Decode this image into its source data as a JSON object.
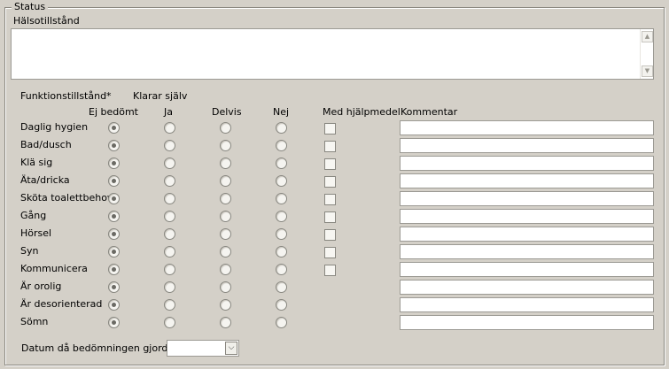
{
  "group_title": "Status",
  "health": {
    "label": "Hälsotillstånd",
    "value": ""
  },
  "function_header": "Funktionstillstånd*",
  "self_header": "Klarar själv",
  "columns": {
    "not_assessed": "Ej bedömt",
    "yes": "Ja",
    "partly": "Delvis",
    "no": "Nej",
    "aid": "Med hjälpmedel",
    "comment": "Kommentar"
  },
  "rows": [
    {
      "label": "Daglig hygien",
      "selected": "not_assessed",
      "has_aid": true
    },
    {
      "label": "Bad/dusch",
      "selected": "not_assessed",
      "has_aid": true
    },
    {
      "label": "Klä sig",
      "selected": "not_assessed",
      "has_aid": true
    },
    {
      "label": "Äta/dricka",
      "selected": "not_assessed",
      "has_aid": true
    },
    {
      "label": "Sköta toalettbehov",
      "selected": "not_assessed",
      "has_aid": true
    },
    {
      "label": "Gång",
      "selected": "not_assessed",
      "has_aid": true
    },
    {
      "label": "Hörsel",
      "selected": "not_assessed",
      "has_aid": true
    },
    {
      "label": "Syn",
      "selected": "not_assessed",
      "has_aid": true
    },
    {
      "label": "Kommunicera",
      "selected": "not_assessed",
      "has_aid": true
    },
    {
      "label": "Är orolig",
      "selected": "not_assessed",
      "has_aid": false
    },
    {
      "label": "Är desorienterad",
      "selected": "not_assessed",
      "has_aid": false
    },
    {
      "label": "Sömn",
      "selected": "not_assessed",
      "has_aid": false
    }
  ],
  "date": {
    "label": "Datum då bedömningen gjordes*:",
    "value": ""
  },
  "icons": {
    "scroll_up": "chevron-up-icon",
    "scroll_down": "chevron-down-icon",
    "dropdown": "chevron-down-icon"
  }
}
